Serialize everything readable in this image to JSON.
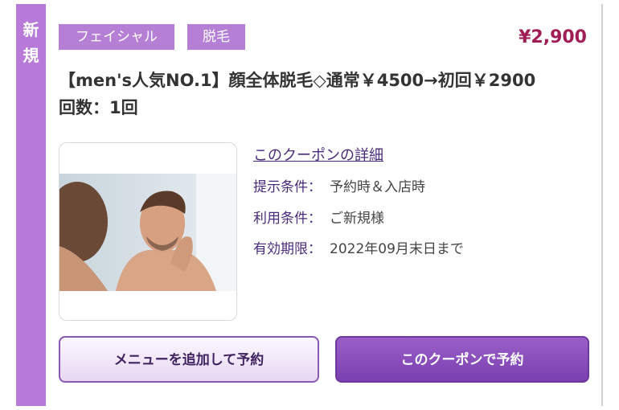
{
  "badge": {
    "new_char_1": "新",
    "new_char_2": "規"
  },
  "tags": [
    "フェイシャル",
    "脱毛"
  ],
  "price": "¥2,900",
  "title": {
    "line1": "【men's人気NO.1】顔全体脱毛◇通常￥4500→初回￥2900",
    "line2": "回数：1回"
  },
  "details": {
    "link": "このクーポンの詳細",
    "rows": [
      {
        "key": "提示条件：",
        "value": "予約時＆入店時"
      },
      {
        "key": "利用条件：",
        "value": "ご新規様"
      },
      {
        "key": "有効期限：",
        "value": "2022年09月末日まで"
      }
    ]
  },
  "buttons": {
    "add_menu": "メニューを追加して予約",
    "book_coupon": "このクーポンで予約"
  },
  "colors": {
    "accent": "#b57fd6",
    "price": "#a01d55",
    "primary_button": "#7a3fb0"
  }
}
